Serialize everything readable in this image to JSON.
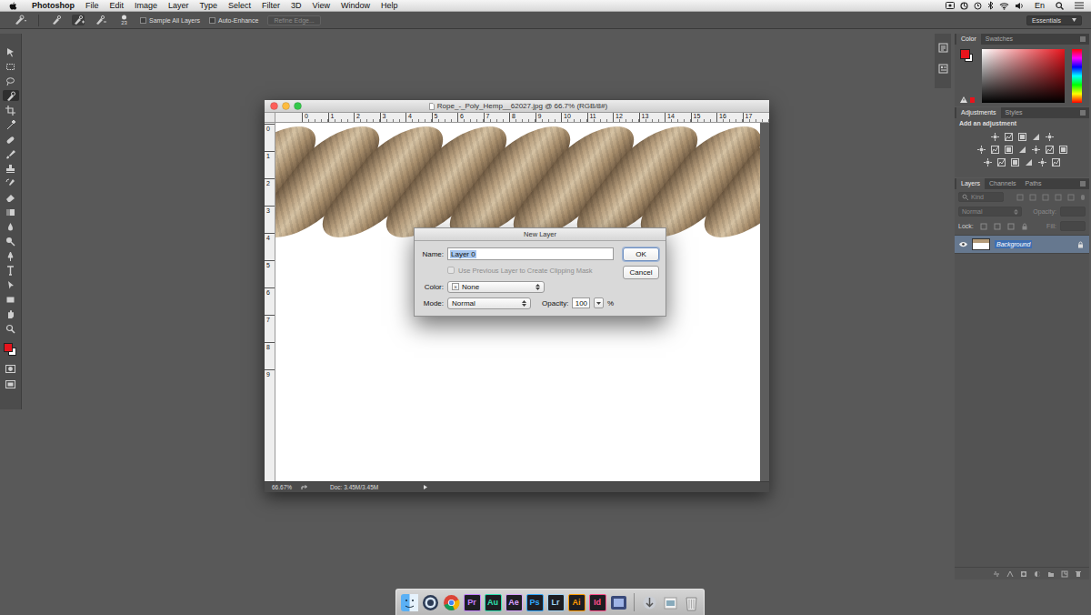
{
  "menu_bar": {
    "app": "Photoshop",
    "items": [
      "File",
      "Edit",
      "Image",
      "Layer",
      "Type",
      "Select",
      "Filter",
      "3D",
      "View",
      "Window",
      "Help"
    ],
    "input_source": "En"
  },
  "options_bar": {
    "brush_size": "23",
    "checkboxes": [
      {
        "label": "Sample All Layers",
        "checked": false
      },
      {
        "label": "Auto-Enhance",
        "checked": false
      }
    ],
    "refine_edge": {
      "label": "Refine Edge...",
      "disabled": true
    },
    "workspace": "Essentials"
  },
  "tools": {
    "items": [
      {
        "selected": false
      },
      {
        "selected": false
      },
      {
        "selected": false
      },
      {
        "selected": true
      },
      {
        "selected": false
      },
      {
        "selected": false
      },
      {
        "selected": false
      },
      {
        "selected": false
      },
      {
        "selected": false
      },
      {
        "selected": false
      },
      {
        "selected": false
      },
      {
        "selected": false
      },
      {
        "selected": false
      },
      {
        "selected": false
      },
      {
        "selected": false
      },
      {
        "selected": false
      },
      {
        "selected": false
      },
      {
        "selected": false
      },
      {
        "selected": false
      },
      {
        "selected": false
      }
    ],
    "foreground": "#e8141c",
    "background": "#ffffff"
  },
  "document": {
    "title": "Rope_-_Poly_Hemp__62027.jpg @ 66.7% (RGB/8#)",
    "ruler_top": [
      "0",
      "1",
      "2",
      "3",
      "4",
      "5",
      "6",
      "7",
      "8",
      "9",
      "10",
      "11",
      "12",
      "13",
      "14",
      "15",
      "16",
      "17"
    ],
    "ruler_left": [
      "0",
      "1",
      "2",
      "3",
      "4",
      "5",
      "6",
      "7",
      "8",
      "9"
    ],
    "zoom": "66.67%",
    "doc_info": "Doc: 3.45M/3.45M"
  },
  "dialog": {
    "title": "New Layer",
    "name_label": "Name:",
    "name_value": "Layer 0",
    "name_selected": true,
    "clip_checkbox": {
      "label": "Use Previous Layer to Create Clipping Mask",
      "checked": false,
      "disabled": true
    },
    "color_label": "Color:",
    "color_icon": "×",
    "color_value": "None",
    "mode_label": "Mode:",
    "mode_value": "Normal",
    "opacity_label": "Opacity:",
    "opacity_value": "100",
    "opacity_unit": "%",
    "buttons": [
      {
        "label": "OK",
        "selected": true
      },
      {
        "label": "Cancel",
        "selected": false
      }
    ]
  },
  "panels": {
    "color": {
      "tabs": [
        {
          "label": "Color",
          "selected": true
        },
        {
          "label": "Swatches",
          "selected": false
        }
      ]
    },
    "adjustments": {
      "tabs": [
        {
          "label": "Adjustments",
          "selected": true
        },
        {
          "label": "Styles",
          "selected": false
        }
      ],
      "heading": "Add an adjustment"
    },
    "layers": {
      "tabs": [
        {
          "label": "Layers",
          "selected": true
        },
        {
          "label": "Channels",
          "selected": false
        },
        {
          "label": "Paths",
          "selected": false
        }
      ],
      "filter": {
        "label": "Kind",
        "disabled": true
      },
      "blend_mode": {
        "label": "Normal",
        "disabled": true
      },
      "opacity": {
        "label": "Opacity:",
        "disabled": true
      },
      "lock": {
        "label": "Lock:",
        "disabled": false
      },
      "fill": {
        "label": "Fill:",
        "disabled": true
      },
      "list": [
        {
          "name": "Background",
          "visible": true,
          "locked": true,
          "selected": true
        }
      ]
    }
  },
  "dock": [
    {
      "label": "Pr",
      "color": "#c580ff"
    },
    {
      "label": "Au",
      "color": "#2ee0b0"
    },
    {
      "label": "Ae",
      "color": "#d8a0ff"
    },
    {
      "label": "Ps",
      "color": "#31a8ff"
    },
    {
      "label": "Lr",
      "color": "#9fd4f5"
    },
    {
      "label": "Ai",
      "color": "#ff9a00"
    },
    {
      "label": "Id",
      "color": "#ff4f8b"
    }
  ]
}
